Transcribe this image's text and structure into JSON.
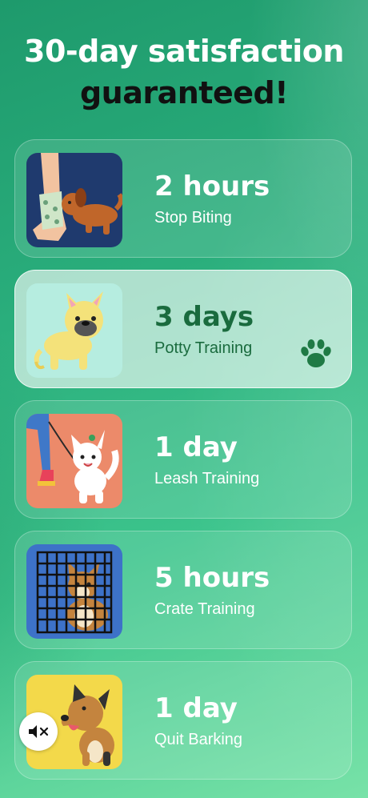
{
  "headline": {
    "line1": "30-day satisfaction",
    "line2": "guaranteed!"
  },
  "programs": [
    {
      "duration": "2 hours",
      "skill": "Stop Biting",
      "icon": "biting-puppy-illustration",
      "selected": false
    },
    {
      "duration": "3 days",
      "skill": "Potty Training",
      "icon": "potty-bulldog-illustration",
      "selected": true
    },
    {
      "duration": "1 day",
      "skill": "Leash Training",
      "icon": "leash-dog-illustration",
      "selected": false
    },
    {
      "duration": "5 hours",
      "skill": "Crate Training",
      "icon": "crate-corgi-illustration",
      "selected": false
    },
    {
      "duration": "1 day",
      "skill": "Quit Barking",
      "icon": "barking-dog-illustration",
      "selected": false
    }
  ],
  "colors": {
    "background_top": "#1e9a6c",
    "background_bottom": "#78e2a8",
    "selected_text": "#1a6b3e",
    "paw": "#1f7a45"
  },
  "controls": {
    "mute_icon": "speaker-muted-icon",
    "selected_indicator_icon": "paw-icon"
  }
}
